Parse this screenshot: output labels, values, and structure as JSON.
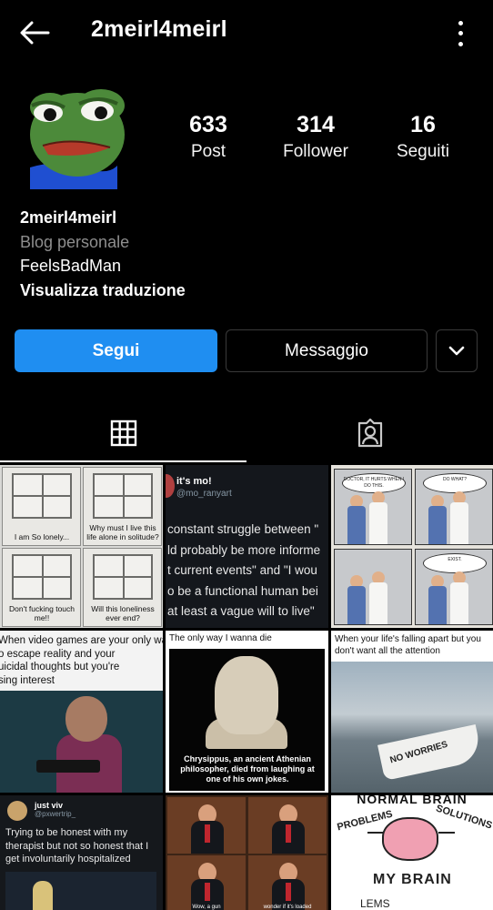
{
  "header": {
    "title": "2meirl4meirl"
  },
  "profile": {
    "stats": [
      {
        "value": "633",
        "label": "Post"
      },
      {
        "value": "314",
        "label": "Follower"
      },
      {
        "value": "16",
        "label": "Seguiti"
      }
    ],
    "name": "2meirl4meirl",
    "category": "Blog personale",
    "bio": "FeelsBadMan",
    "translate_link": "Visualizza traduzione"
  },
  "actions": {
    "follow_label": "Segui",
    "message_label": "Messaggio"
  },
  "tabs": [
    {
      "icon": "grid-icon",
      "active": true
    },
    {
      "icon": "tagged-icon",
      "active": false
    }
  ],
  "posts": {
    "p1": {
      "panels": [
        "I am So lonely...",
        "Why must I live this life alone in solitude?",
        "Don't fucking touch me!!",
        "Will this loneliness ever end?"
      ]
    },
    "p2": {
      "user": "it's mo!",
      "handle": "@mo_ranyart",
      "lines": [
        "constant struggle between \"",
        "ld probably be more informe",
        "t current events\" and \"I wou",
        "o be a functional human bei",
        "at least a vague will to live\""
      ]
    },
    "p3": {
      "bubbles": [
        "DOCTOR, IT HURTS WHEN I DO THIS.",
        "DO WHAT?",
        "",
        "EXIST."
      ]
    },
    "p4": {
      "caption_lines": [
        "When video games are your only way",
        "o escape reality and your",
        "uicidal thoughts but you're",
        "sing interest"
      ]
    },
    "p5": {
      "caption": "The only way I wanna die",
      "text": "Chrysippus, an ancient Athenian philosopher, died from laughing at one of his own jokes."
    },
    "p6": {
      "caption": "When your life's falling apart but you don't want all the attention",
      "boat_text": "NO WORRIES"
    },
    "p7": {
      "user": "just viv",
      "handle": "@pxwertrip_",
      "text": "Trying to be honest with my therapist but not so honest that I get involuntarily hospitalized"
    },
    "p8": {
      "subs": [
        "",
        "",
        "Wow, a gun",
        "wonder if it's loaded"
      ]
    },
    "p9": {
      "top": "NORMAL BRAIN",
      "left": "PROBLEMS",
      "right": "SOLUTIONS",
      "main": "MY BRAIN",
      "bottom": "LEMS"
    }
  }
}
